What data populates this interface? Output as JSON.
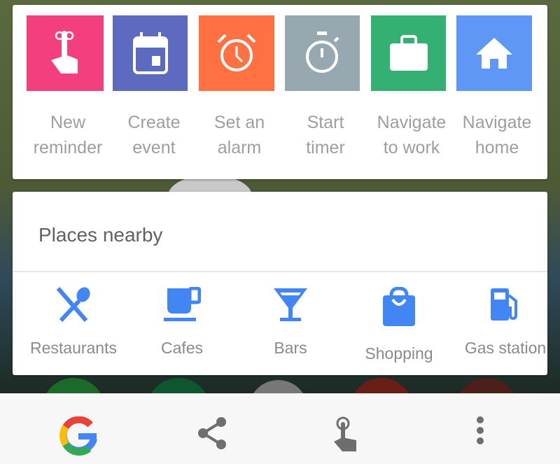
{
  "actions": [
    {
      "label_line1": "New",
      "label_line2": "reminder",
      "icon": "reminder-finger-icon",
      "color": "#f43f7f"
    },
    {
      "label_line1": "Create",
      "label_line2": "event",
      "icon": "calendar-icon",
      "color": "#5c6bc0"
    },
    {
      "label_line1": "Set an",
      "label_line2": "alarm",
      "icon": "alarm-clock-icon",
      "color": "#ff7043"
    },
    {
      "label_line1": "Start",
      "label_line2": "timer",
      "icon": "stopwatch-icon",
      "color": "#90a4ae"
    },
    {
      "label_line1": "Navigate",
      "label_line2": "to work",
      "icon": "briefcase-icon",
      "color": "#33b072"
    },
    {
      "label_line1": "Navigate",
      "label_line2": "home",
      "icon": "home-icon",
      "color": "#5e97f6"
    }
  ],
  "places": {
    "title": "Places nearby",
    "accent": "#4285f4",
    "items": [
      {
        "label": "Restaurants",
        "icon": "fork-spoon-icon"
      },
      {
        "label": "Cafes",
        "icon": "coffee-cup-icon"
      },
      {
        "label": "Bars",
        "icon": "cocktail-icon"
      },
      {
        "label": "Shopping",
        "icon": "shopping-bag-icon"
      },
      {
        "label": "Gas station",
        "icon": "gas-pump-icon"
      }
    ]
  },
  "bottom_bar": {
    "items": [
      {
        "icon": "google-g-icon"
      },
      {
        "icon": "share-icon"
      },
      {
        "icon": "tap-gesture-icon"
      },
      {
        "icon": "more-vert-icon"
      }
    ]
  }
}
